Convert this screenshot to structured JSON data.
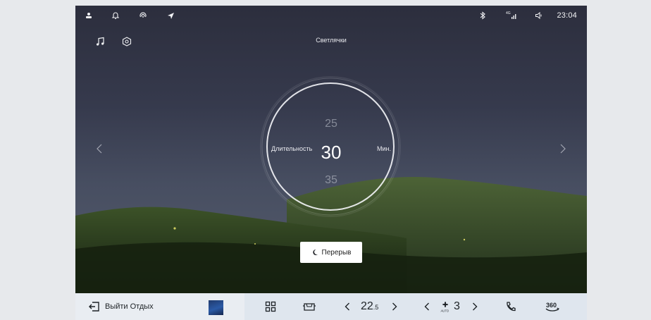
{
  "status_bar": {
    "time": "23:04",
    "network": "4G",
    "icons": [
      "person-icon",
      "bell-icon",
      "hotspot-icon",
      "navigation-arrow-icon",
      "bluetooth-icon",
      "signal-icon",
      "volume-icon"
    ]
  },
  "scene": {
    "title": "Светлячки",
    "left_icons": [
      "music-note-icon",
      "settings-hex-icon"
    ]
  },
  "timer": {
    "label": "Длительность",
    "unit": "Мин.",
    "prev_value": "25",
    "current_value": "30",
    "next_value": "35"
  },
  "break_button": {
    "label": "Перерыв"
  },
  "dock": {
    "exit_label": "Выйти Отдых",
    "temperature_main": "22",
    "temperature_decimal": ".5",
    "fan_level": "3",
    "fan_mode": "AUTO",
    "view_360_label": "360"
  },
  "colors": {
    "sky_top": "#2c2e3d",
    "dock_bg": "#dfe6ee",
    "button_bg": "#ffffff"
  }
}
